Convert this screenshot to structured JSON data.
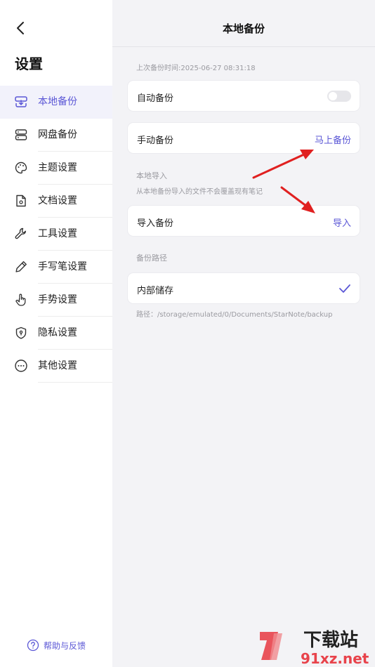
{
  "sidebar": {
    "title": "设置",
    "items": [
      {
        "label": "本地备份",
        "icon": "backup-download-icon"
      },
      {
        "label": "网盘备份",
        "icon": "server-icon"
      },
      {
        "label": "主题设置",
        "icon": "palette-icon"
      },
      {
        "label": "文档设置",
        "icon": "document-gear-icon"
      },
      {
        "label": "工具设置",
        "icon": "wrench-icon"
      },
      {
        "label": "手写笔设置",
        "icon": "pen-icon"
      },
      {
        "label": "手势设置",
        "icon": "hand-pointer-icon"
      },
      {
        "label": "隐私设置",
        "icon": "shield-icon"
      },
      {
        "label": "其他设置",
        "icon": "more-dots-icon"
      }
    ],
    "help_label": "帮助与反馈"
  },
  "main": {
    "title": "本地备份",
    "last_backup": "上次备份时间:2025-06-27 08:31:18",
    "auto_backup_label": "自动备份",
    "auto_backup_enabled": false,
    "manual_backup_label": "手动备份",
    "manual_backup_action": "马上备份",
    "import_section_title": "本地导入",
    "import_note": "从本地备份导入的文件不会覆盖现有笔记",
    "import_label": "导入备份",
    "import_action": "导入",
    "path_section_title": "备份路径",
    "storage_label": "内部储存",
    "path_text": "路径：/storage/emulated/0/Documents/StarNote/backup"
  },
  "watermark": {
    "line1": "下载站",
    "line2": "91xz.net"
  },
  "colors": {
    "accent": "#5b57d6",
    "arrow": "#e02020"
  }
}
